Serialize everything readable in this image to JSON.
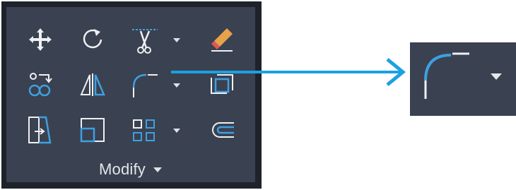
{
  "panel": {
    "title": "Modify",
    "colors": {
      "background": "#3a4150",
      "frame": "#1e222b",
      "icon_white": "#eef0f3",
      "icon_blue": "#3ea0e0",
      "accent_orange": "#e8a24a",
      "accent_red": "#e0594e"
    },
    "tools": [
      {
        "icon": "move-icon",
        "row": 1,
        "col": 1
      },
      {
        "icon": "rotate-icon",
        "row": 1,
        "col": 2
      },
      {
        "icon": "trim-icon",
        "row": 1,
        "col": 3,
        "dropdown": true
      },
      {
        "icon": "erase-icon",
        "row": 1,
        "col": 4
      },
      {
        "icon": "copy-icon",
        "row": 2,
        "col": 1
      },
      {
        "icon": "mirror-icon",
        "row": 2,
        "col": 2
      },
      {
        "icon": "fillet-icon",
        "row": 2,
        "col": 3,
        "dropdown": true
      },
      {
        "icon": "explode-icon",
        "row": 2,
        "col": 4
      },
      {
        "icon": "stretch-icon",
        "row": 3,
        "col": 1
      },
      {
        "icon": "scale-icon",
        "row": 3,
        "col": 2
      },
      {
        "icon": "array-icon",
        "row": 3,
        "col": 3,
        "dropdown": true
      },
      {
        "icon": "offset-icon",
        "row": 3,
        "col": 4
      }
    ]
  },
  "callout": {
    "icon": "fillet-icon",
    "dropdown": true,
    "arrow_color": "#1ba1e2"
  }
}
